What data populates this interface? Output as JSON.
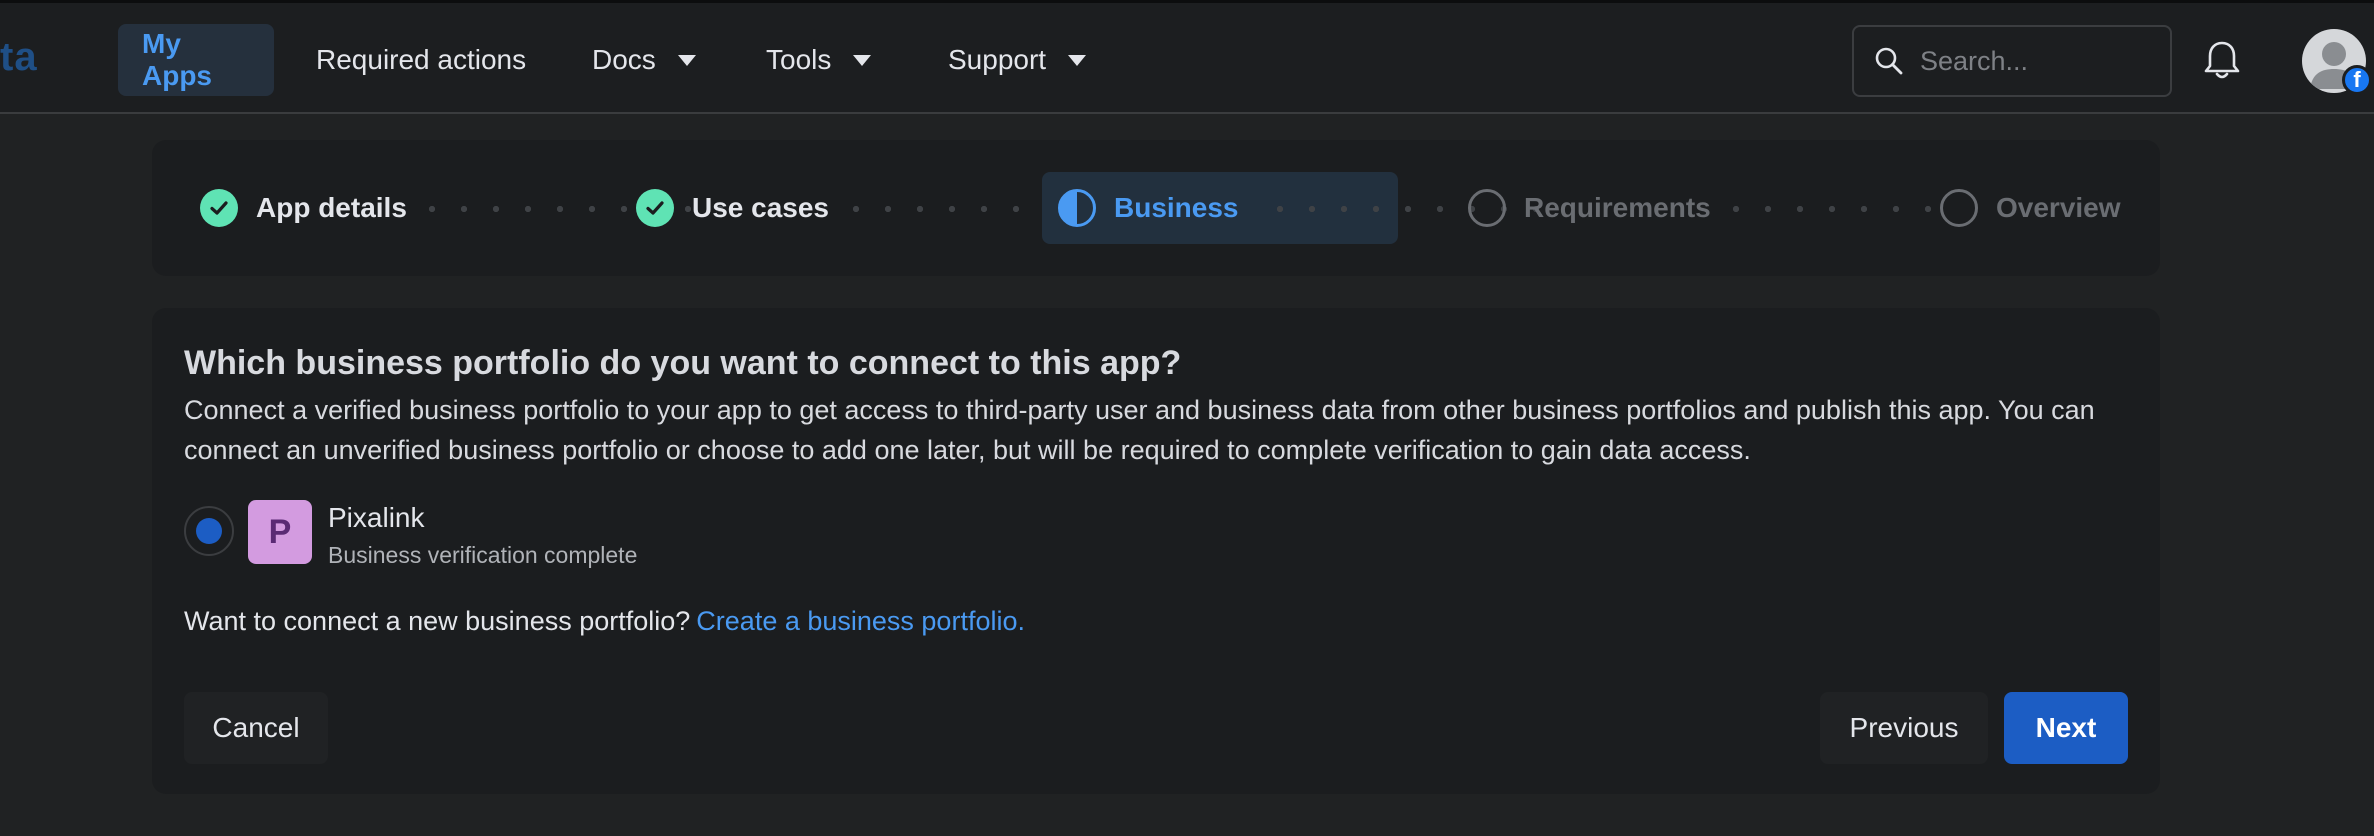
{
  "nav": {
    "logo_fragment": "ta",
    "my_apps": "My Apps",
    "required_actions": "Required actions",
    "docs": "Docs",
    "tools": "Tools",
    "support": "Support",
    "search_placeholder": "Search..."
  },
  "stepper": {
    "steps": [
      {
        "label": "App details",
        "state": "done"
      },
      {
        "label": "Use cases",
        "state": "done"
      },
      {
        "label": "Business",
        "state": "current"
      },
      {
        "label": "Requirements",
        "state": "pending"
      },
      {
        "label": "Overview",
        "state": "pending"
      }
    ]
  },
  "card": {
    "title": "Which business portfolio do you want to connect to this app?",
    "description": "Connect a verified business portfolio to your app to get access to third-party user and business data from other business portfolios and publish this app. You can connect an unverified business portfolio or choose to add one later, but will be required to complete verification to gain data access.",
    "portfolio": {
      "initial": "P",
      "name": "Pixalink",
      "status": "Business verification complete"
    },
    "cta_text": "Want to connect a new business portfolio?",
    "cta_link": "Create a business portfolio."
  },
  "buttons": {
    "cancel": "Cancel",
    "previous": "Previous",
    "next": "Next"
  },
  "colors": {
    "accent": "#4a9af2",
    "primary_button": "#1c5dc4",
    "step_done": "#5fe3b4",
    "background": "#202223"
  },
  "icons": {
    "search": "search-icon",
    "notifications": "bell-icon",
    "check": "check-icon",
    "badge": "facebook-badge-icon"
  }
}
